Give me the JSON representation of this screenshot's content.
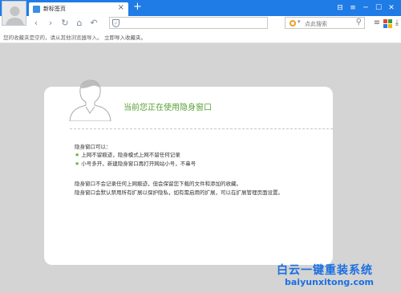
{
  "tab": {
    "title": "新标签页",
    "close": "×"
  },
  "new_tab": "+",
  "window_controls": [
    "⊟",
    "≡",
    "─",
    "☐",
    "✕"
  ],
  "toolbar": {
    "nav": [
      "‹",
      "›",
      "↻",
      "⌂",
      "↶"
    ],
    "shield": "✓",
    "search_caret": "▾",
    "search_placeholder": "点此搜索",
    "search_go": "⚲",
    "tools": [
      "≡",
      "⤓"
    ]
  },
  "favorites_bar": {
    "message": "您的收藏夹是空的，请从其他浏览器导入。",
    "link": "立即导入收藏夹。"
  },
  "card": {
    "title": "当前您正在使用隐身窗口",
    "section_heading": "隐身窗口可以：",
    "features": [
      "上网不留痕迹，隐身模式上网不留任何记录",
      "小号多开，新建隐身窗口再打开网站小号，不串号"
    ],
    "notes": [
      "隐身窗口不会记录任何上网痕迹，但会保留您下载的文件和添加的收藏。",
      "隐身窗口会默认禁用所有扩展以保护隐私，如有需启用的扩展，可以在扩展管理页面设置。"
    ]
  },
  "watermark": {
    "text_cn": "白云一键重装系统",
    "text_en": "baiyunxitong.com"
  }
}
